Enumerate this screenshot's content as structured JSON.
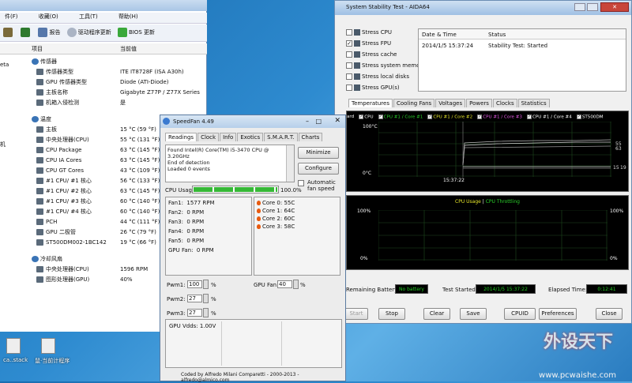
{
  "aida": {
    "menu": [
      "件(F)",
      "收藏(O)",
      "工具(T)",
      "帮助(H)"
    ],
    "toolbar": [
      "报告",
      "驱动程序更新",
      "BIOS 更新"
    ],
    "col_item": "项目",
    "col_value": "当前值",
    "left_labels": [
      "eta",
      "机"
    ],
    "groups": [
      {
        "name": "传感器",
        "rows": [
          {
            "name": "传感器类型",
            "value": "ITE IT8728F (ISA A30h)"
          },
          {
            "name": "GPU 传感器类型",
            "value": "Diode (ATI-Diode)"
          },
          {
            "name": "主板名称",
            "value": "Gigabyte Z77P / Z77X Series"
          },
          {
            "name": "机箱入侵检测",
            "value": "是"
          }
        ]
      },
      {
        "name": "温度",
        "rows": [
          {
            "name": "主板",
            "value": "15 °C (59 °F)"
          },
          {
            "name": "中央处理器(CPU)",
            "value": "55 °C (131 °F)"
          },
          {
            "name": "CPU Package",
            "value": "63 °C (145 °F)"
          },
          {
            "name": "CPU IA Cores",
            "value": "63 °C (145 °F)"
          },
          {
            "name": "CPU GT Cores",
            "value": "43 °C (109 °F)"
          },
          {
            "name": "#1 CPU/ #1 核心",
            "value": "56 °C (133 °F)"
          },
          {
            "name": "#1 CPU/ #2 核心",
            "value": "63 °C (145 °F)"
          },
          {
            "name": "#1 CPU/ #3 核心",
            "value": "60 °C (140 °F)"
          },
          {
            "name": "#1 CPU/ #4 核心",
            "value": "60 °C (140 °F)"
          },
          {
            "name": "PCH",
            "value": "44 °C (111 °F)"
          },
          {
            "name": "GPU 二极管",
            "value": "26 °C (79 °F)"
          },
          {
            "name": "ST500DM002-1BC142",
            "value": "19 °C (66 °F)"
          }
        ]
      },
      {
        "name": "冷却风扇",
        "rows": [
          {
            "name": "中央处理器(CPU)",
            "value": "1596 RPM"
          },
          {
            "name": "图形处理器(GPU)",
            "value": "40%"
          }
        ]
      }
    ]
  },
  "stability": {
    "title": "System Stability Test - AIDA64",
    "options": [
      {
        "label": "Stress CPU",
        "checked": false
      },
      {
        "label": "Stress FPU",
        "checked": true
      },
      {
        "label": "Stress cache",
        "checked": false
      },
      {
        "label": "Stress system memory",
        "checked": false
      },
      {
        "label": "Stress local disks",
        "checked": false
      },
      {
        "label": "Stress GPU(s)",
        "checked": false
      }
    ],
    "log_headers": [
      "Date & Time",
      "Status"
    ],
    "log_rows": [
      {
        "time": "2014/1/5 15:37:24",
        "status": "Stability Test: Started"
      }
    ],
    "tabs": [
      "Temperatures",
      "Cooling Fans",
      "Voltages",
      "Powers",
      "Clocks",
      "Statistics"
    ],
    "legend": [
      "ard",
      "CPU",
      "CPU #1 / Core #1",
      "CPU #1 / Core #2",
      "CPU #1 / Core #3",
      "CPU #1 / Core #4",
      "ST500DM"
    ],
    "temp_graph": {
      "ymax": "100°C",
      "ymin": "0°C",
      "xlabel": "15:37:22",
      "right_top": [
        "55",
        "63"
      ],
      "right_bottom": [
        "15",
        "19"
      ]
    },
    "usage_graph": {
      "title_a": "CPU Usage",
      "sep": "|",
      "title_b": "CPU Throttling",
      "ymax_l": "100%",
      "ymin_l": "0%",
      "ymax_r": "100%",
      "ymin_r": "0%"
    },
    "status": {
      "battery_label": "Remaining Battery:",
      "battery": "No battery",
      "started_label": "Test Started:",
      "started": "2014/1/5 15:37:22",
      "elapsed_label": "Elapsed Time:",
      "elapsed": "0:12:41"
    },
    "buttons": [
      "Start",
      "Stop",
      "Clear",
      "Save",
      "CPUID",
      "Preferences",
      "Close"
    ],
    "colors": {
      "usage_title_a": "#e6e62a",
      "usage_title_b": "#2ad02a",
      "lcd": "#22cc22"
    }
  },
  "speedfan": {
    "title": "SpeedFan 4.49",
    "tabs": [
      "Readings",
      "Clock",
      "Info",
      "Exotics",
      "S.M.A.R.T.",
      "Charts"
    ],
    "log": [
      "Found Intel(R) Core(TM) i5-3470 CPU @ 3.20GHz",
      "End of detection",
      "Loaded 0 events"
    ],
    "minimize": "Minimize",
    "configure": "Configure",
    "auto_fan": "Automatic fan speed",
    "cpu_usage_label": "CPU Usage",
    "cpu_usage_value": "100.0%",
    "fans": [
      "Fan1:  1577 RPM",
      "Fan2:  0 RPM",
      "Fan3:  0 RPM",
      "Fan4:  0 RPM",
      "Fan5:  0 RPM",
      "GPU Fan:  0 RPM"
    ],
    "cores": [
      "Core 0: 55C",
      "Core 1: 64C",
      "Core 2: 60C",
      "Core 3: 58C"
    ],
    "pwm": [
      {
        "label": "Pwm1:",
        "value": "100"
      },
      {
        "label": "Pwm2:",
        "value": "27"
      },
      {
        "label": "Pwm3:",
        "value": "27"
      }
    ],
    "gpu_fan_label": "GPU Fan:",
    "gpu_fan_value": "40",
    "percent": "%",
    "vdd": "GPU Vdds:   1.00V",
    "footer": "Coded by Alfredo Milani Comparetti - 2000-2013 - alfredo@almico.com"
  },
  "desktop": {
    "icons": [
      "ca..stack",
      "鼠·当前计程序"
    ],
    "watermark_big": "外设天下",
    "watermark_url": "www.pcwaishe.com"
  }
}
